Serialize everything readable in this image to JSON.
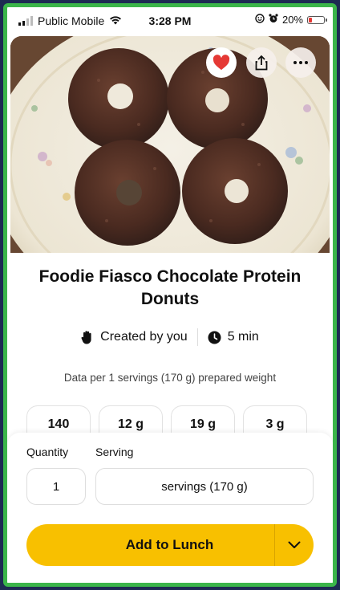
{
  "status_bar": {
    "carrier": "Public Mobile",
    "time": "3:28 PM",
    "battery_percent": "20%",
    "icons": [
      "signal-icon",
      "wifi-icon",
      "focus-icon",
      "alarm-icon",
      "battery-icon"
    ]
  },
  "hero": {
    "image_subject": "four chocolate protein donuts on a floral plate",
    "actions": [
      "heart-icon",
      "share-icon",
      "more-icon"
    ],
    "liked": true
  },
  "recipe": {
    "title": "Foodie Fiasco Chocolate Protein Donuts",
    "created_by": "Created by you",
    "time": "5 min",
    "data_line": "Data per 1 servings (170 g) prepared weight"
  },
  "nutrition": [
    "140",
    "12 g",
    "19 g",
    "3 g"
  ],
  "sheet": {
    "quantity_label": "Quantity",
    "serving_label": "Serving",
    "quantity_value": "1",
    "serving_value": "servings (170 g)",
    "add_button": "Add to Lunch"
  },
  "colors": {
    "accent": "#f8c000",
    "frame_border": "#3bb54a",
    "heart": "#e53935"
  }
}
